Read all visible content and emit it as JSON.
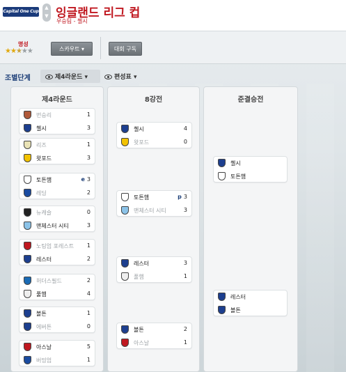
{
  "header": {
    "logo_text": "Capital One Cup",
    "title": "잉글랜드 리그 컵",
    "subtitle": "우승팀 - 첼시"
  },
  "toolbar": {
    "fame_label": "명성",
    "stars_filled": 2.5,
    "stars_total": 5,
    "scout_label": "스카우트",
    "subscribe_label": "대회 구독"
  },
  "filters": {
    "group_label": "조별단계",
    "round_label": "제4라운드",
    "schedule_label": "편성표"
  },
  "columns": [
    {
      "title": "제4라운드",
      "matches": [
        {
          "home": {
            "name": "번승리",
            "score": "1",
            "winner": false,
            "crest": "#b05a3a"
          },
          "away": {
            "name": "첼시",
            "score": "3",
            "winner": true,
            "crest": "#1d3f8f"
          }
        },
        {
          "home": {
            "name": "리즈",
            "score": "1",
            "winner": false,
            "crest": "#e9e2b5"
          },
          "away": {
            "name": "왓포드",
            "score": "3",
            "winner": true,
            "crest": "#f2c200"
          }
        },
        {
          "home": {
            "name": "토튼햄",
            "note": "e",
            "score": "3",
            "winner": true,
            "crest": "#ffffff"
          },
          "away": {
            "name": "레딩",
            "score": "2",
            "winner": false,
            "crest": "#1a4ba0"
          }
        },
        {
          "home": {
            "name": "뉴캐슬",
            "score": "0",
            "winner": false,
            "crest": "#222222"
          },
          "away": {
            "name": "맨체스터 시티",
            "score": "3",
            "winner": true,
            "crest": "#8cc3e8"
          }
        },
        {
          "home": {
            "name": "노팅엄 포레스트",
            "score": "1",
            "winner": false,
            "crest": "#c01820"
          },
          "away": {
            "name": "레스터",
            "score": "2",
            "winner": true,
            "crest": "#1d3f8f"
          }
        },
        {
          "home": {
            "name": "허더스필드",
            "score": "2",
            "winner": false,
            "crest": "#1a6bb5"
          },
          "away": {
            "name": "풀햄",
            "score": "4",
            "winner": true,
            "crest": "#eeeeee"
          }
        },
        {
          "home": {
            "name": "볼튼",
            "score": "1",
            "winner": true,
            "crest": "#1d3f8f"
          },
          "away": {
            "name": "에버튼",
            "score": "0",
            "winner": false,
            "crest": "#1d3f8f"
          }
        },
        {
          "home": {
            "name": "아스날",
            "score": "5",
            "winner": true,
            "crest": "#c01820"
          },
          "away": {
            "name": "버밍엄",
            "score": "1",
            "winner": false,
            "crest": "#1a4ba0"
          }
        }
      ]
    },
    {
      "title": "8강전",
      "matches": [
        {
          "home": {
            "name": "첼시",
            "score": "4",
            "winner": true,
            "crest": "#1d3f8f"
          },
          "away": {
            "name": "왓포드",
            "score": "0",
            "winner": false,
            "crest": "#f2c200"
          }
        },
        {
          "home": {
            "name": "토튼햄",
            "note": "p",
            "score": "3",
            "winner": true,
            "crest": "#ffffff"
          },
          "away": {
            "name": "맨체스터 시티",
            "score": "3",
            "winner": false,
            "crest": "#8cc3e8"
          }
        },
        {
          "home": {
            "name": "레스터",
            "score": "3",
            "winner": true,
            "crest": "#1d3f8f"
          },
          "away": {
            "name": "풀햄",
            "score": "1",
            "winner": false,
            "crest": "#eeeeee"
          }
        },
        {
          "home": {
            "name": "볼튼",
            "score": "2",
            "winner": true,
            "crest": "#1d3f8f"
          },
          "away": {
            "name": "아스날",
            "score": "1",
            "winner": false,
            "crest": "#c01820"
          }
        }
      ]
    },
    {
      "title": "준결승전",
      "matches": [
        {
          "home": {
            "name": "첼시",
            "score": "",
            "winner": true,
            "crest": "#1d3f8f"
          },
          "away": {
            "name": "토튼햄",
            "score": "",
            "winner": true,
            "crest": "#ffffff"
          }
        },
        {
          "home": {
            "name": "레스터",
            "score": "",
            "winner": true,
            "crest": "#1d3f8f"
          },
          "away": {
            "name": "볼튼",
            "score": "",
            "winner": true,
            "crest": "#1d3f8f"
          }
        }
      ]
    }
  ]
}
